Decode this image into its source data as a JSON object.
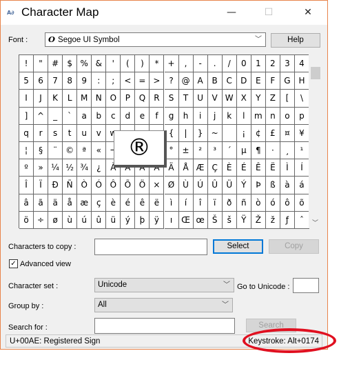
{
  "window": {
    "title": "Character Map",
    "minimize": "—",
    "maximize": "☐",
    "close": "✕"
  },
  "font": {
    "label": "Font :",
    "value": "Segoe UI Symbol",
    "icon": "opentype-icon"
  },
  "help_label": "Help",
  "grid": {
    "rows": [
      [
        "!",
        "\"",
        "#",
        "$",
        "%",
        "&",
        "'",
        "(",
        ")",
        "*",
        "+",
        ",",
        "-",
        ".",
        "/",
        "0",
        "1",
        "2",
        "3",
        "4"
      ],
      [
        "5",
        "6",
        "7",
        "8",
        "9",
        ":",
        ";",
        "<",
        "=",
        ">",
        "?",
        "@",
        "A",
        "B",
        "C",
        "D",
        "E",
        "F",
        "G",
        "H"
      ],
      [
        "I",
        "J",
        "K",
        "L",
        "M",
        "N",
        "O",
        "P",
        "Q",
        "R",
        "S",
        "T",
        "U",
        "V",
        "W",
        "X",
        "Y",
        "Z",
        "[",
        "\\"
      ],
      [
        "]",
        "^",
        "_",
        "`",
        "a",
        "b",
        "c",
        "d",
        "e",
        "f",
        "g",
        "h",
        "i",
        "j",
        "k",
        "l",
        "m",
        "n",
        "o",
        "p"
      ],
      [
        "q",
        "r",
        "s",
        "t",
        "u",
        "v",
        "w",
        "x",
        "y",
        "z",
        "{",
        "|",
        "}",
        "~",
        " ",
        "¡",
        "¢",
        "£",
        "¤",
        "¥"
      ],
      [
        "¦",
        "§",
        "¨",
        "©",
        "ª",
        "«",
        "¬",
        "­",
        "®",
        "¯",
        "°",
        "±",
        "²",
        "³",
        "´",
        "µ",
        "¶",
        "·",
        "¸",
        "¹"
      ],
      [
        "º",
        "»",
        "¼",
        "½",
        "¾",
        "¿",
        "À",
        "Á",
        "Â",
        "Ã",
        "Ä",
        "Å",
        "Æ",
        "Ç",
        "È",
        "É",
        "Ê",
        "Ë",
        "Ì",
        "Í"
      ],
      [
        "Î",
        "Ï",
        "Ð",
        "Ñ",
        "Ò",
        "Ó",
        "Ô",
        "Õ",
        "Ö",
        "×",
        "Ø",
        "Ù",
        "Ú",
        "Û",
        "Ü",
        "Ý",
        "Þ",
        "ß",
        "à",
        "á"
      ],
      [
        "â",
        "ã",
        "ä",
        "å",
        "æ",
        "ç",
        "è",
        "é",
        "ê",
        "ë",
        "ì",
        "í",
        "î",
        "ï",
        "ð",
        "ñ",
        "ò",
        "ó",
        "ô",
        "õ"
      ],
      [
        "ö",
        "÷",
        "ø",
        "ù",
        "ú",
        "û",
        "ü",
        "ý",
        "þ",
        "ÿ",
        "ı",
        "Œ",
        "œ",
        "Š",
        "š",
        "Ÿ",
        "Ž",
        "ž",
        "ƒ",
        "ˆ"
      ]
    ],
    "selected": "®"
  },
  "copy": {
    "label": "Characters to copy :",
    "value": "",
    "select": "Select",
    "copy": "Copy"
  },
  "advanced": {
    "label": "Advanced view",
    "checked": true
  },
  "charset": {
    "label": "Character set :",
    "value": "Unicode"
  },
  "goto": {
    "label": "Go to Unicode :",
    "value": ""
  },
  "groupby": {
    "label": "Group by :",
    "value": "All"
  },
  "search": {
    "label": "Search for :",
    "value": "",
    "button": "Search"
  },
  "status": {
    "left": "U+00AE: Registered Sign",
    "right": "Keystroke: Alt+0174"
  },
  "colors": {
    "annotation": "#e01020",
    "focus": "#0078d7",
    "border": "#e8834a"
  }
}
